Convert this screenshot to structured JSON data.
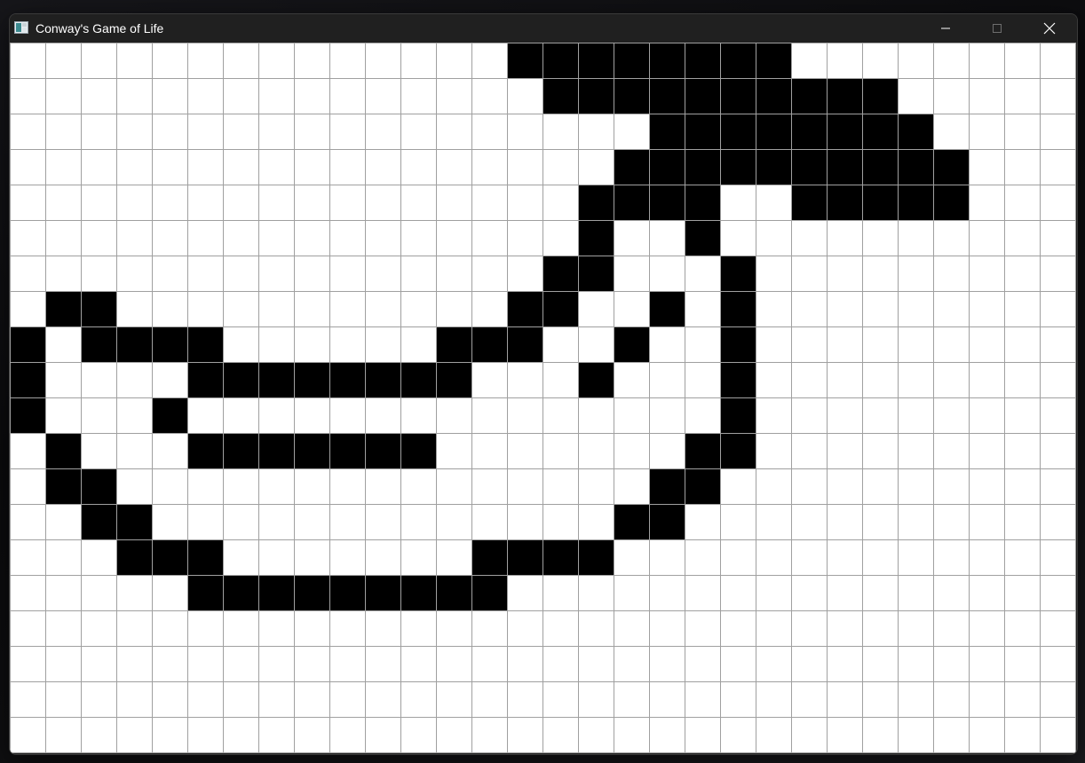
{
  "window": {
    "title": "Conway's Game of Life"
  },
  "icons": {
    "app": "app-window-icon",
    "minimize": "minimize-icon",
    "maximize": "maximize-icon",
    "close": "close-icon"
  },
  "colors": {
    "alive": "#000000",
    "dead": "#ffffff",
    "grid_line": "#a0a0a0",
    "titlebar": "#202020",
    "title_text": "#ffffff"
  },
  "board": {
    "columns": 30,
    "rows": 20,
    "alive_cells": [
      [
        0,
        14
      ],
      [
        0,
        15
      ],
      [
        0,
        16
      ],
      [
        0,
        17
      ],
      [
        0,
        18
      ],
      [
        0,
        19
      ],
      [
        0,
        20
      ],
      [
        0,
        21
      ],
      [
        1,
        15
      ],
      [
        1,
        16
      ],
      [
        1,
        17
      ],
      [
        1,
        18
      ],
      [
        1,
        19
      ],
      [
        1,
        20
      ],
      [
        1,
        21
      ],
      [
        1,
        22
      ],
      [
        1,
        23
      ],
      [
        1,
        24
      ],
      [
        2,
        18
      ],
      [
        2,
        19
      ],
      [
        2,
        20
      ],
      [
        2,
        21
      ],
      [
        2,
        22
      ],
      [
        2,
        23
      ],
      [
        2,
        24
      ],
      [
        2,
        25
      ],
      [
        3,
        17
      ],
      [
        3,
        18
      ],
      [
        3,
        19
      ],
      [
        3,
        20
      ],
      [
        3,
        21
      ],
      [
        3,
        22
      ],
      [
        3,
        23
      ],
      [
        3,
        24
      ],
      [
        3,
        25
      ],
      [
        3,
        26
      ],
      [
        4,
        16
      ],
      [
        4,
        17
      ],
      [
        4,
        18
      ],
      [
        4,
        19
      ],
      [
        4,
        22
      ],
      [
        4,
        23
      ],
      [
        4,
        24
      ],
      [
        4,
        25
      ],
      [
        4,
        26
      ],
      [
        5,
        16
      ],
      [
        5,
        19
      ],
      [
        6,
        15
      ],
      [
        6,
        16
      ],
      [
        6,
        20
      ],
      [
        7,
        1
      ],
      [
        7,
        2
      ],
      [
        7,
        14
      ],
      [
        7,
        15
      ],
      [
        7,
        18
      ],
      [
        7,
        20
      ],
      [
        8,
        0
      ],
      [
        8,
        2
      ],
      [
        8,
        3
      ],
      [
        8,
        4
      ],
      [
        8,
        5
      ],
      [
        8,
        12
      ],
      [
        8,
        13
      ],
      [
        8,
        14
      ],
      [
        8,
        17
      ],
      [
        8,
        20
      ],
      [
        9,
        0
      ],
      [
        9,
        5
      ],
      [
        9,
        6
      ],
      [
        9,
        7
      ],
      [
        9,
        8
      ],
      [
        9,
        9
      ],
      [
        9,
        10
      ],
      [
        9,
        11
      ],
      [
        9,
        12
      ],
      [
        9,
        16
      ],
      [
        9,
        20
      ],
      [
        10,
        0
      ],
      [
        10,
        4
      ],
      [
        10,
        20
      ],
      [
        11,
        1
      ],
      [
        11,
        5
      ],
      [
        11,
        6
      ],
      [
        11,
        7
      ],
      [
        11,
        8
      ],
      [
        11,
        9
      ],
      [
        11,
        10
      ],
      [
        11,
        11
      ],
      [
        11,
        19
      ],
      [
        11,
        20
      ],
      [
        12,
        1
      ],
      [
        12,
        2
      ],
      [
        12,
        18
      ],
      [
        12,
        19
      ],
      [
        13,
        2
      ],
      [
        13,
        3
      ],
      [
        13,
        17
      ],
      [
        13,
        18
      ],
      [
        14,
        3
      ],
      [
        14,
        4
      ],
      [
        14,
        5
      ],
      [
        14,
        13
      ],
      [
        14,
        14
      ],
      [
        14,
        15
      ],
      [
        14,
        16
      ],
      [
        15,
        5
      ],
      [
        15,
        6
      ],
      [
        15,
        7
      ],
      [
        15,
        8
      ],
      [
        15,
        9
      ],
      [
        15,
        10
      ],
      [
        15,
        11
      ],
      [
        15,
        12
      ],
      [
        15,
        13
      ]
    ]
  }
}
